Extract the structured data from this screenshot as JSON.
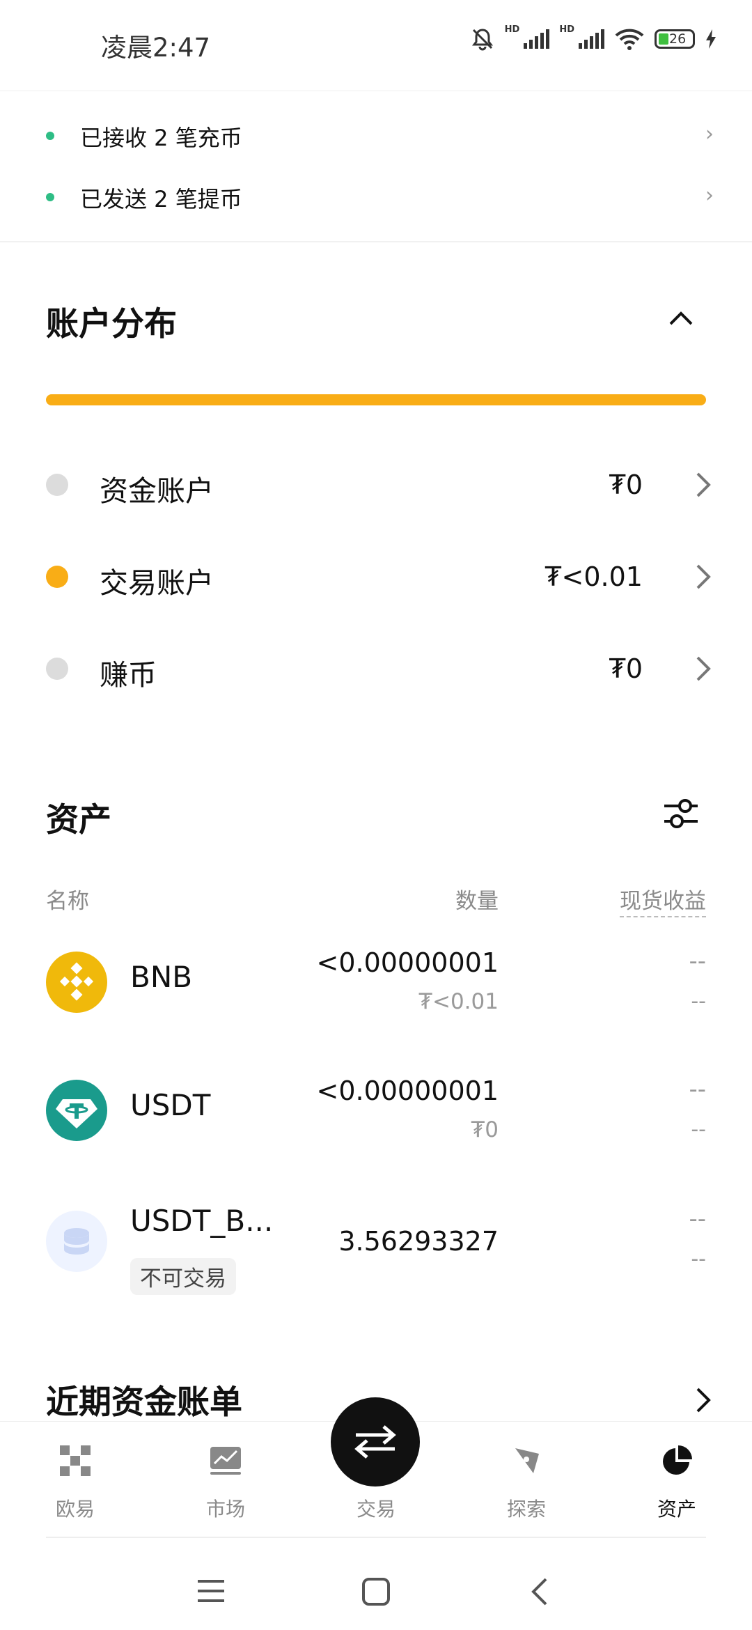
{
  "status_bar": {
    "time": "凌晨2:47",
    "hd1": "HD",
    "hd2": "HD",
    "battery": "26"
  },
  "notifications": [
    {
      "text": "已接收 2 笔充币"
    },
    {
      "text": "已发送 2 笔提币"
    }
  ],
  "distribution": {
    "title": "账户分布",
    "accounts": [
      {
        "name": "资金账户",
        "value": "₮0",
        "dot_color": "#dcdcdc"
      },
      {
        "name": "交易账户",
        "value": "₮<0.01",
        "dot_color": "#f9ad16"
      },
      {
        "name": "赚币",
        "value": "₮0",
        "dot_color": "#dcdcdc"
      }
    ]
  },
  "assets": {
    "title": "资产",
    "columns": {
      "name": "名称",
      "quantity": "数量",
      "pnl": "现货收益"
    },
    "rows": [
      {
        "name": "BNB",
        "quantity": "<0.00000001",
        "fiat": "₮<0.01",
        "pnl": "--",
        "pnl2": "--",
        "icon": "bnb-logo-icon"
      },
      {
        "name": "USDT",
        "quantity": "<0.00000001",
        "fiat": "₮0",
        "pnl": "--",
        "pnl2": "--",
        "icon": "usdt-logo-icon"
      },
      {
        "name": "USDT_B...",
        "badge": "不可交易",
        "quantity": "3.56293327",
        "pnl": "--",
        "pnl2": "--",
        "icon": "coins-stack-icon"
      }
    ]
  },
  "recent_bills": {
    "title": "近期资金账单"
  },
  "bottom_nav": {
    "items": [
      {
        "label": "欧易",
        "icon": "okx-logo-icon"
      },
      {
        "label": "市场",
        "icon": "market-chart-icon"
      },
      {
        "label": "交易",
        "icon": "swap-arrows-icon"
      },
      {
        "label": "探索",
        "icon": "compass-icon"
      },
      {
        "label": "资产",
        "icon": "pie-chart-icon",
        "active": true
      }
    ]
  },
  "colors": {
    "accent": "#f9ad16",
    "green": "#2ebd85",
    "usdt": "#1a9b8c",
    "bnb": "#f0b90b"
  }
}
